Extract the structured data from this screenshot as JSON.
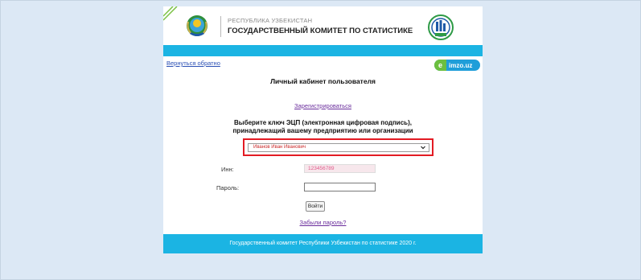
{
  "header": {
    "republic": "РЕСПУБЛИКА УЗБЕКИСТАН",
    "committee": "ГОСУДАРСТВЕННЫЙ КОМИТЕТ ПО СТАТИСТИКЕ",
    "stat_logo_text": "uzstat"
  },
  "nav": {
    "back_link": "Вернуться обратно",
    "imzo_label": "imzo.uz"
  },
  "main": {
    "title": "Личный кабинет пользователя",
    "register_link": "Зарегистрироваться",
    "choose_key_line1": "Выберите ключ ЭЦП (электронная цифровая подпись),",
    "choose_key_line2": "принадлежащий вашему предприятию или организации",
    "selected_key": "Иванов Иван Иванович",
    "inn_label": "Инн:",
    "inn_value": "123456789",
    "password_label": "Пароль:",
    "password_value": "",
    "login_button": "Войти",
    "forgot_link": "Забыли пароль?"
  },
  "footer": {
    "text": "Государственный комитет Республики Узбекистан по статистике 2020 г."
  },
  "colors": {
    "background": "#dce8f5",
    "accent_bar": "#1bb4e3",
    "highlight": "#e31b23",
    "link_visited": "#6a2d9c",
    "link": "#2a4fb4"
  },
  "icons": [
    "emblem-icon",
    "stat-logo-icon",
    "corner-flag-icon",
    "chevron-down-icon"
  ]
}
